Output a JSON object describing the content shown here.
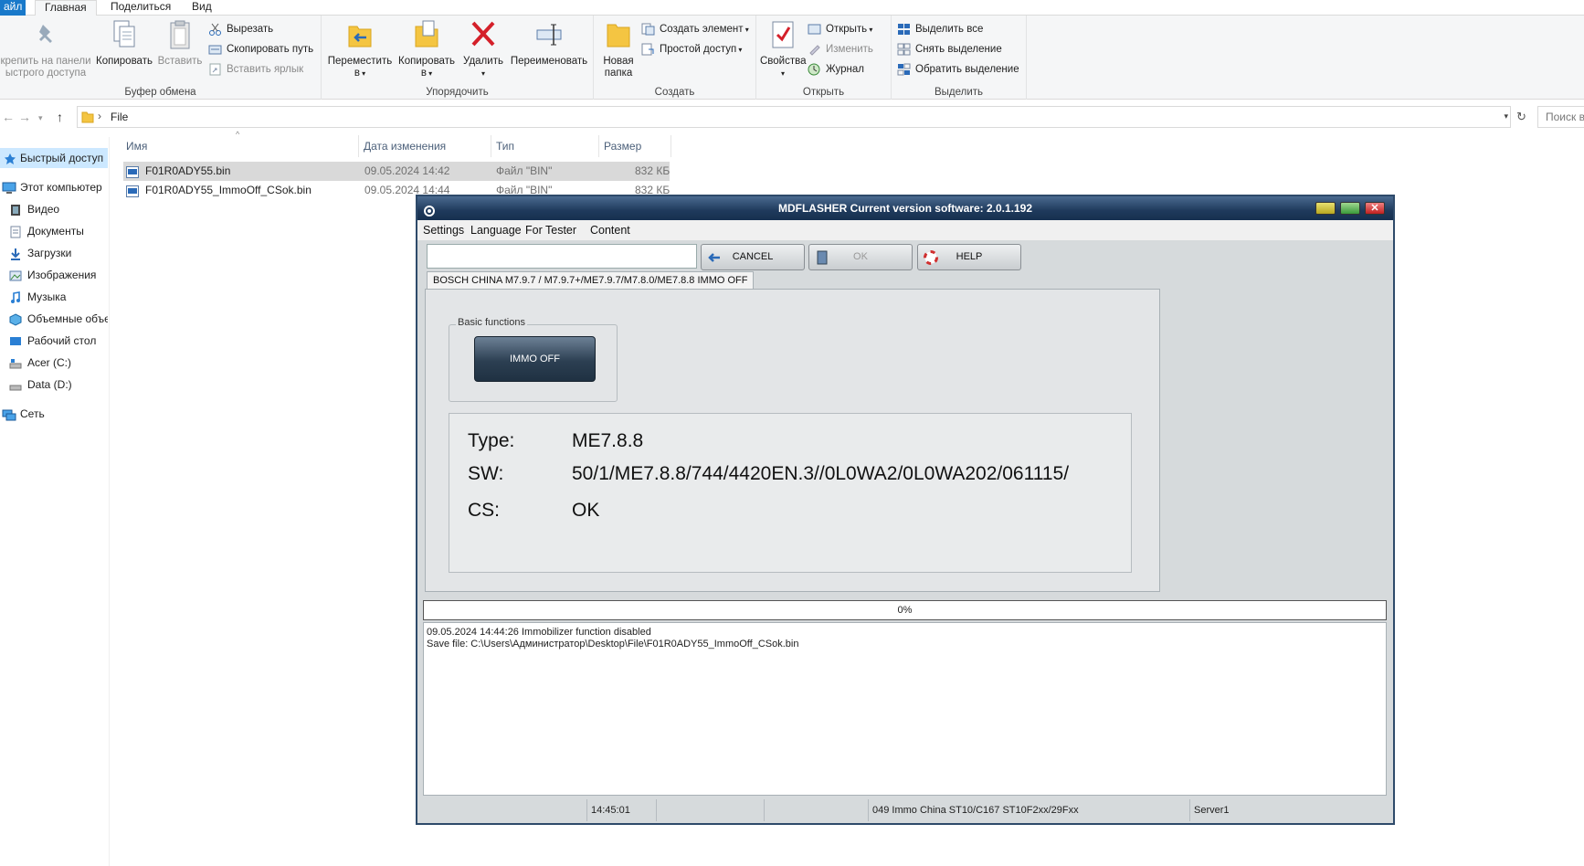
{
  "ribbon": {
    "tabs": {
      "file": "айл",
      "home": "Главная",
      "share": "Поделиться",
      "view": "Вид"
    },
    "pin": {
      "line1": "крепить на панели",
      "line2": "ыстрого доступа"
    },
    "copy": "Копировать",
    "paste": "Вставить",
    "cut": "Вырезать",
    "copy_path": "Скопировать путь",
    "paste_shortcut": "Вставить ярлык",
    "clipboard_group": "Буфер обмена",
    "move": {
      "line1": "Переместить",
      "line2": "в"
    },
    "copy_to": {
      "line1": "Копировать",
      "line2": "в"
    },
    "delete": "Удалить",
    "rename": "Переименовать",
    "organize_group": "Упорядочить",
    "new_folder": {
      "line1": "Новая",
      "line2": "папка"
    },
    "new_item": "Создать элемент",
    "easy_access": "Простой доступ",
    "create_group": "Создать",
    "properties": "Свойства",
    "open": "Открыть",
    "edit": "Изменить",
    "history": "Журнал",
    "open_group": "Открыть",
    "select_all": "Выделить все",
    "select_none": "Снять выделение",
    "invert": "Обратить выделение",
    "select_group": "Выделить"
  },
  "address": {
    "path": "File",
    "search_placeholder": "Поиск в"
  },
  "nav": {
    "quick": "Быстрый доступ",
    "pc": "Этот компьютер",
    "video": "Видео",
    "docs": "Документы",
    "downloads": "Загрузки",
    "images": "Изображения",
    "music": "Музыка",
    "objects": "Объемные объекты",
    "desktop": "Рабочий стол",
    "c": "Acer (C:)",
    "d": "Data (D:)",
    "network": "Сеть"
  },
  "columns": {
    "name": "Имя",
    "date": "Дата изменения",
    "type": "Тип",
    "size": "Размер"
  },
  "files": [
    {
      "name": "F01R0ADY55.bin",
      "date": "09.05.2024 14:42",
      "type": "Файл \"BIN\"",
      "size": "832 КБ"
    },
    {
      "name": "F01R0ADY55_ImmoOff_CSok.bin",
      "date": "09.05.2024 14:44",
      "type": "Файл \"BIN\"",
      "size": "832 КБ"
    }
  ],
  "md": {
    "title": "MDFLASHER  Current version software: 2.0.1.192",
    "menu": {
      "settings": "Settings",
      "language": "Language",
      "tester": "For Tester",
      "content": "Content"
    },
    "input_value": "",
    "cancel": "CANCEL",
    "ok": "OK",
    "help": "HELP",
    "tab": "BOSCH  CHINA M7.9.7 / M7.9.7+/ME7.9.7/M7.8.0/ME7.8.8  IMMO OFF",
    "basic_label": "Basic functions",
    "immo_btn": "IMMO OFF",
    "type_label": "Type:",
    "type_value": "ME7.8.8",
    "sw_label": "SW:",
    "sw_value": "50/1/ME7.8.8/744/4420EN.3//0L0WA2/0L0WA202/061115/",
    "cs_label": "CS:",
    "cs_value": "OK",
    "progress": "0%",
    "progress_value": 0,
    "log": [
      "09.05.2024 14:44:26  Immobilizer function disabled",
      "Save file: C:\\Users\\Администратор\\Desktop\\File\\F01R0ADY55_ImmoOff_CSok.bin"
    ],
    "status": {
      "time": "14:45:01",
      "module": "049 Immo China ST10/C167 ST10F2xx/29Fxx",
      "server": "Server1"
    }
  },
  "colors": {
    "accent": "#1979ca",
    "title_bar": "#1f3a5c",
    "selection": "#cce8ff"
  }
}
